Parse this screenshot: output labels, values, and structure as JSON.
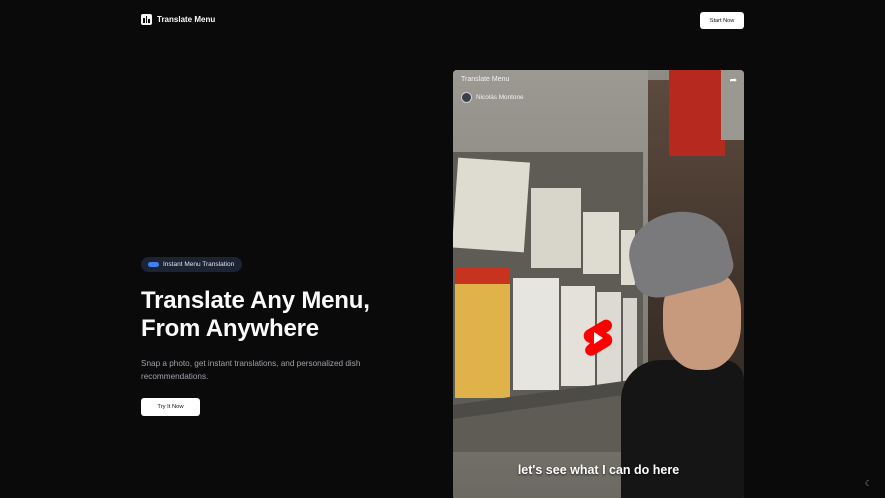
{
  "header": {
    "logo_text": "Translate Menu",
    "start_button": "Start Now"
  },
  "hero": {
    "badge": "Instant Menu Translation",
    "headline_line1": "Translate Any Menu,",
    "headline_line2": "From Anywhere",
    "subtext": "Snap a photo, get instant translations, and personalized dish recommendations.",
    "cta": "Try It Now"
  },
  "video": {
    "title": "Translate Menu",
    "channel": "Nicolás Montone",
    "caption": "let's see what I can do here",
    "play_icon": "youtube-shorts-play-icon",
    "share_icon": "share-icon"
  },
  "footer": {
    "theme_toggle_icon": "moon-icon"
  },
  "colors": {
    "background": "#0a0a0b",
    "badge_bg": "#1c2333",
    "badge_dot": "#3b82f6",
    "play_red": "#ff0000"
  }
}
